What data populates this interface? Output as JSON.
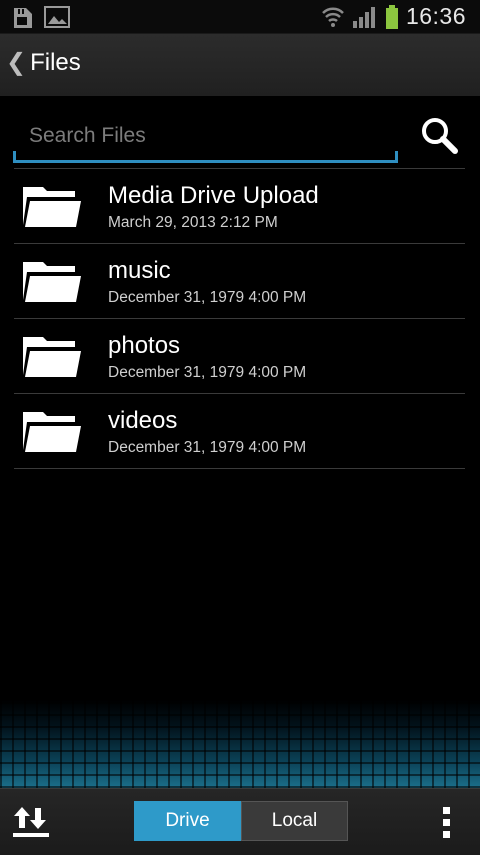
{
  "status_bar": {
    "time": "16:36",
    "icons": [
      "sd-card-icon",
      "image-notification-icon",
      "wifi-icon",
      "signal-icon",
      "battery-charging-icon"
    ]
  },
  "action_bar": {
    "title": "Files",
    "back_icon": "chevron-left-icon"
  },
  "search": {
    "placeholder": "Search Files",
    "value": "",
    "icon": "search-icon",
    "accent_color": "#2f8fc1"
  },
  "files": [
    {
      "name": "Media Drive Upload",
      "date": "March 29, 2013 2:12 PM",
      "icon": "folder-icon"
    },
    {
      "name": "music",
      "date": "December 31, 1979 4:00 PM",
      "icon": "folder-icon"
    },
    {
      "name": "photos",
      "date": "December 31, 1979 4:00 PM",
      "icon": "folder-icon"
    },
    {
      "name": "videos",
      "date": "December 31, 1979 4:00 PM",
      "icon": "folder-icon"
    }
  ],
  "bottom_bar": {
    "upload_icon": "upload-download-icon",
    "tabs": [
      {
        "label": "Drive",
        "selected": true
      },
      {
        "label": "Local",
        "selected": false
      }
    ],
    "menu_icon": "overflow-menu-icon",
    "selected_color": "#2e9ac9"
  }
}
